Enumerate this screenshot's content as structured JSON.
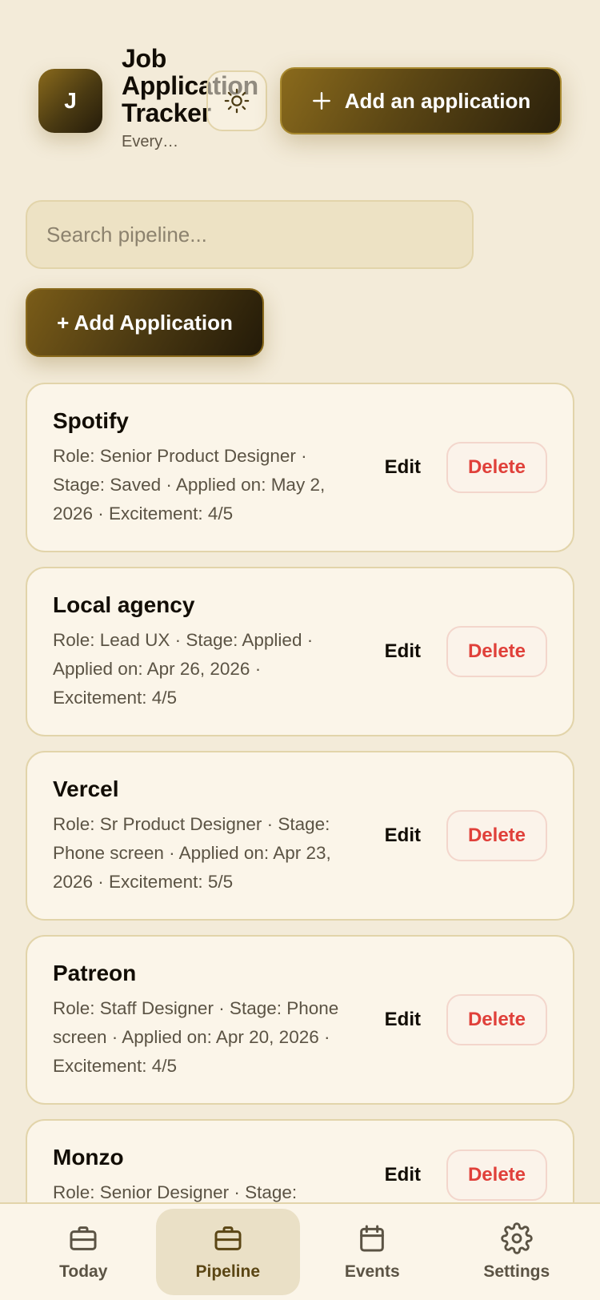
{
  "header": {
    "avatar_letter": "J",
    "title": "Job Application Tracker",
    "subtitle": "Every…",
    "theme_icon": "sun-icon",
    "add_button_label": "Add an application"
  },
  "search": {
    "placeholder": "Search pipeline...",
    "value": ""
  },
  "add_application_label": "+ Add Application",
  "applications": [
    {
      "company": "Spotify",
      "details": "Role: Senior Product Designer · Stage: Saved · Applied on: May 2, 2026 · Excitement: 4/5",
      "edit_label": "Edit",
      "delete_label": "Delete"
    },
    {
      "company": "Local agency",
      "details": "Role: Lead UX · Stage: Applied · Applied on: Apr 26, 2026 · Excitement: 4/5",
      "edit_label": "Edit",
      "delete_label": "Delete"
    },
    {
      "company": "Vercel",
      "details": "Role: Sr Product Designer · Stage: Phone screen · Applied on: Apr 23, 2026 · Excitement: 5/5",
      "edit_label": "Edit",
      "delete_label": "Delete"
    },
    {
      "company": "Patreon",
      "details": "Role: Staff Designer · Stage: Phone screen · Applied on: Apr 20, 2026 · Excitement: 4/5",
      "edit_label": "Edit",
      "delete_label": "Delete"
    },
    {
      "company": "Monzo",
      "details": "Role: Senior Designer · Stage:",
      "edit_label": "Edit",
      "delete_label": "Delete"
    }
  ],
  "nav": {
    "items": [
      {
        "label": "Today",
        "icon": "briefcase-icon",
        "active": false
      },
      {
        "label": "Pipeline",
        "icon": "briefcase-icon",
        "active": true
      },
      {
        "label": "Events",
        "icon": "calendar-icon",
        "active": false
      },
      {
        "label": "Settings",
        "icon": "gear-icon",
        "active": false
      }
    ]
  },
  "colors": {
    "background": "#f3ebd9",
    "accent_dark": "#2a200b",
    "accent_gold": "#8a6a1c",
    "danger": "#e0403a"
  }
}
